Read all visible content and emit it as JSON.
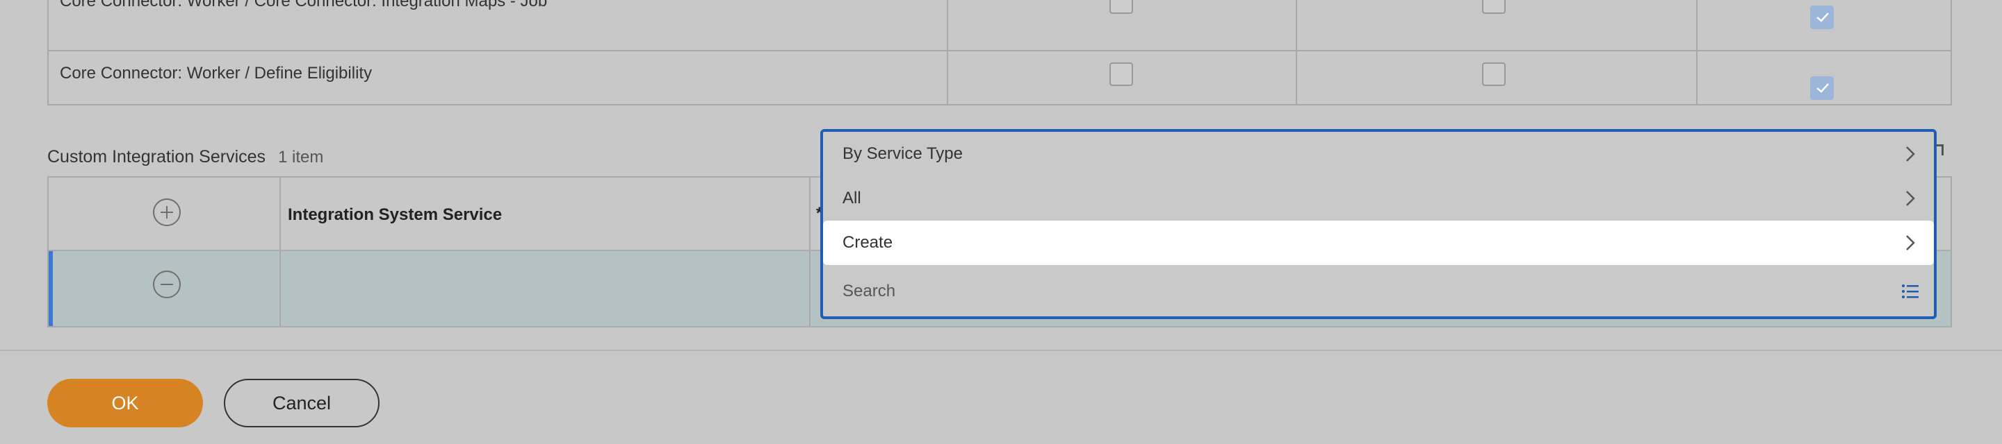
{
  "upper_table": {
    "rows": [
      {
        "label": "Core Connector: Worker / Core Connector: Integration Maps - Job",
        "checks": [
          false,
          false,
          true
        ]
      },
      {
        "label": "Core Connector: Worker / Define Eligibility",
        "checks": [
          false,
          false,
          true
        ]
      }
    ]
  },
  "custom_services": {
    "title": "Custom Integration Services",
    "count": "1 item",
    "header": {
      "column_label": "Integration System Service",
      "required_marker": "*"
    }
  },
  "dropdown": {
    "items": [
      {
        "label": "By Service Type",
        "icon": "chevron-right-icon"
      },
      {
        "label": "All",
        "icon": "chevron-right-icon"
      },
      {
        "label": "Create",
        "icon": "chevron-right-icon"
      },
      {
        "label": "Search",
        "icon": "list-icon"
      }
    ],
    "active_index": 2
  },
  "footer": {
    "ok_label": "OK",
    "cancel_label": "Cancel"
  },
  "colors": {
    "accent_blue": "#1f5cb2",
    "ok_orange": "#d68324",
    "checked_blue": "#9bb6d8",
    "selected_row": "#b5c2c4"
  }
}
